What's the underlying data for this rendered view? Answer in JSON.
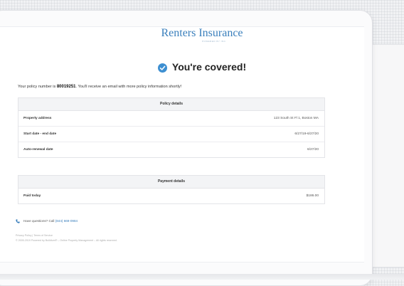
{
  "brand": {
    "name": "Renters Insurance",
    "tagline": "POWERED BY INC."
  },
  "header": {
    "title": "You're covered!"
  },
  "policy": {
    "prefix": "Your policy number is ",
    "number": "80019251",
    "suffix": ". You'll receive an email with more policy information shortly!"
  },
  "policy_details": {
    "heading": "Policy details",
    "rows": [
      {
        "label": "Property address",
        "value": "123 South St Fl 1, Boston MA"
      },
      {
        "label": "Start date - end date",
        "value": "6/27/19-6/27/20"
      },
      {
        "label": "Auto-renewal date",
        "value": "6/27/20"
      }
    ]
  },
  "payment_details": {
    "heading": "Payment details",
    "rows": [
      {
        "label": "Paid today",
        "value": "$186.00"
      }
    ]
  },
  "help": {
    "text": "Have questions? Call ",
    "phone": "(844) 669-0984"
  },
  "footer": {
    "links": "Privacy Policy | Terms of Service",
    "copyright": "© 2005-2019 Powered by Buildium® – Online Property Management – All rights reserved."
  },
  "colors": {
    "accent": "#3a7fbc",
    "check": "#3d8fd1"
  },
  "icons": {
    "check": "check-circle-icon",
    "phone": "phone-icon"
  }
}
